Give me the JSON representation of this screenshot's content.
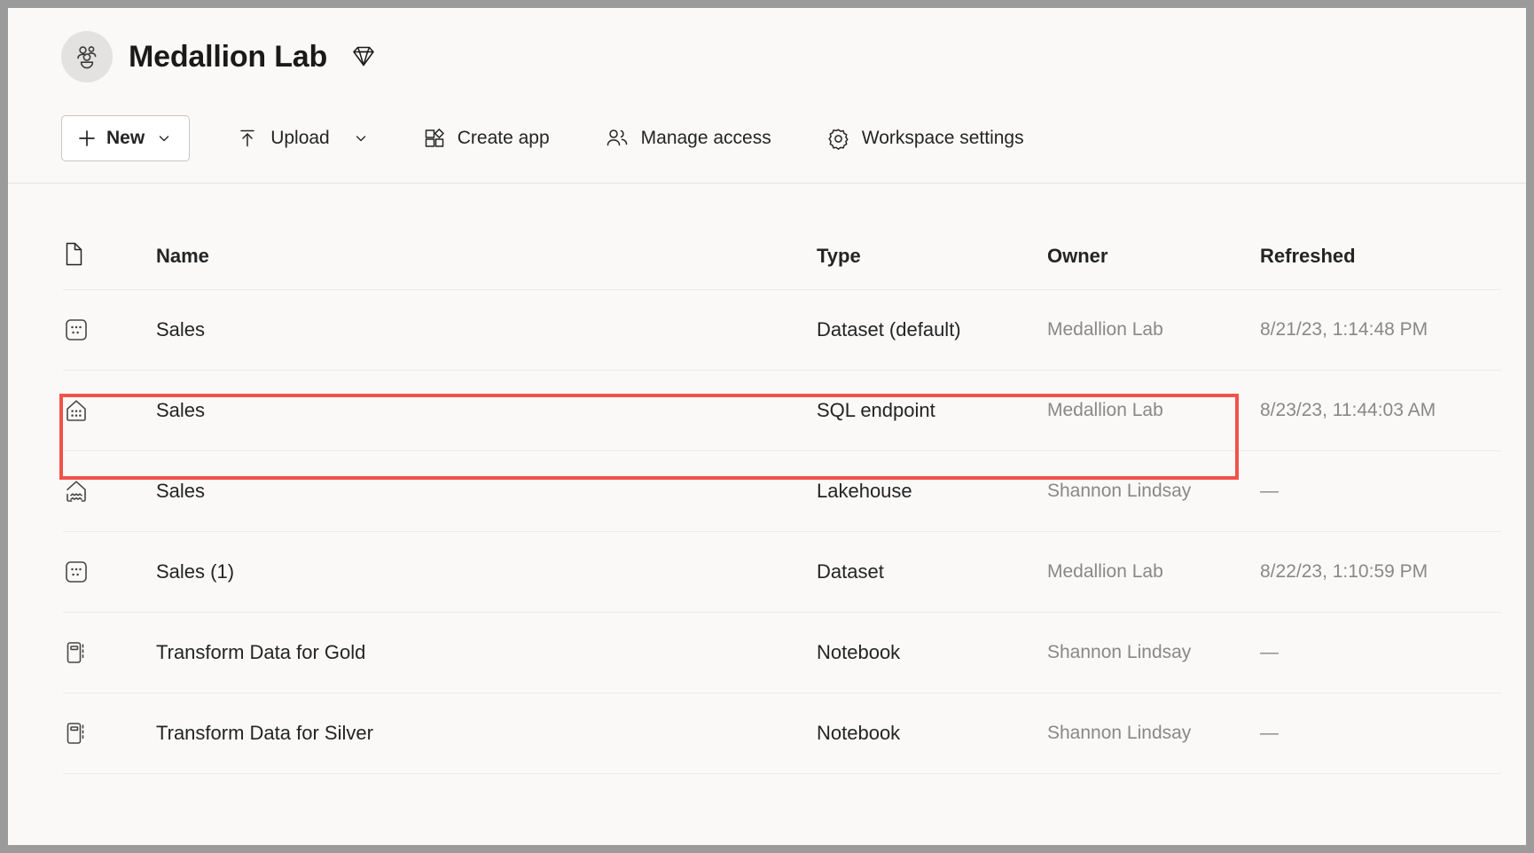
{
  "window": {
    "background_color": "#faf9f8",
    "outer_border_color": "#9b9b9b"
  },
  "header": {
    "avatar_icon": "workspace-people-icon",
    "workspace_name": "Medallion Lab",
    "premium_icon": "diamond-icon"
  },
  "toolbar": {
    "new_label": "New",
    "new_icon": "plus-icon",
    "new_chevron_icon": "chevron-down-icon",
    "upload_label": "Upload",
    "upload_icon": "upload-arrow-icon",
    "upload_chevron_icon": "chevron-down-icon",
    "create_app_label": "Create app",
    "create_app_icon": "app-grid-icon",
    "manage_access_label": "Manage access",
    "manage_access_icon": "people-icon",
    "workspace_settings_label": "Workspace settings",
    "workspace_settings_icon": "gear-icon"
  },
  "list": {
    "columns": {
      "icon": "document-icon",
      "name": "Name",
      "type": "Type",
      "owner": "Owner",
      "refreshed": "Refreshed"
    },
    "rows": [
      {
        "icon": "dataset-icon",
        "name": "Sales",
        "type": "Dataset (default)",
        "owner": "Medallion Lab",
        "refreshed": "8/21/23, 1:14:48 PM",
        "highlighted": false
      },
      {
        "icon": "sql-endpoint-icon",
        "name": "Sales",
        "type": "SQL endpoint",
        "owner": "Medallion Lab",
        "refreshed": "8/23/23, 11:44:03 AM",
        "highlighted": true
      },
      {
        "icon": "lakehouse-icon",
        "name": "Sales",
        "type": "Lakehouse",
        "owner": "Shannon Lindsay",
        "refreshed": "—",
        "highlighted": false
      },
      {
        "icon": "dataset-icon",
        "name": "Sales (1)",
        "type": "Dataset",
        "owner": "Medallion Lab",
        "refreshed": "8/22/23, 1:10:59 PM",
        "highlighted": false
      },
      {
        "icon": "notebook-icon",
        "name": "Transform Data for Gold",
        "type": "Notebook",
        "owner": "Shannon Lindsay",
        "refreshed": "—",
        "highlighted": false
      },
      {
        "icon": "notebook-icon",
        "name": "Transform Data for Silver",
        "type": "Notebook",
        "owner": "Shannon Lindsay",
        "refreshed": "—",
        "highlighted": false
      }
    ]
  },
  "annotation": {
    "highlight_color": "#f2524b",
    "highlight_target": "SQL endpoint"
  }
}
